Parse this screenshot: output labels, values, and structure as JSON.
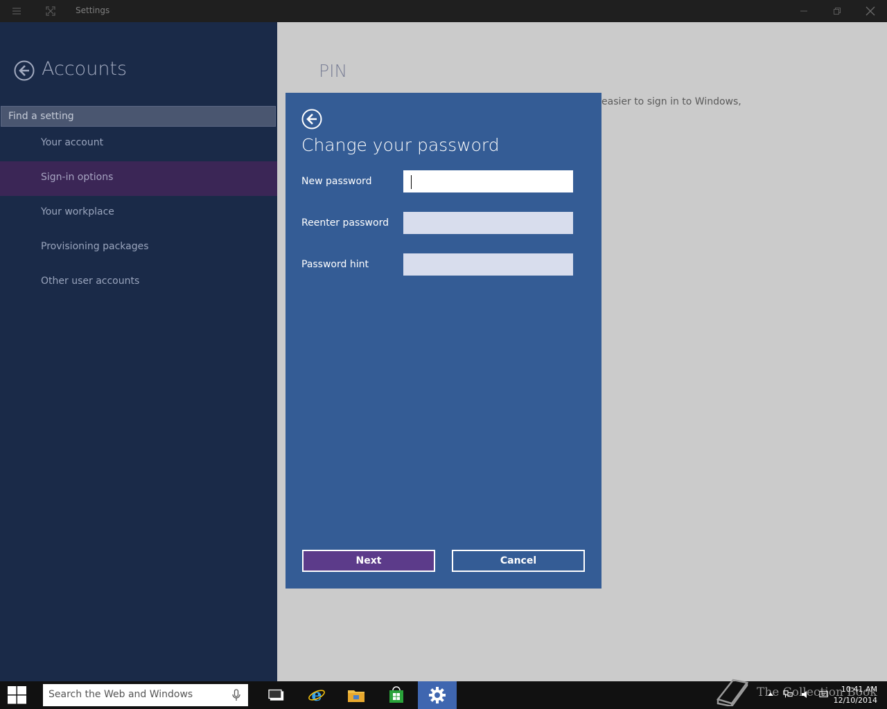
{
  "window": {
    "title": "Settings"
  },
  "sidebar": {
    "section_title": "Accounts",
    "search_placeholder": "Find a setting",
    "items": [
      {
        "label": "Your account",
        "selected": false
      },
      {
        "label": "Sign-in options",
        "selected": true
      },
      {
        "label": "Your workplace",
        "selected": false
      },
      {
        "label": "Provisioning packages",
        "selected": false
      },
      {
        "label": "Other user accounts",
        "selected": false
      }
    ]
  },
  "content": {
    "title": "PIN",
    "description_fragment": "easier to sign in to Windows,"
  },
  "dialog": {
    "title": "Change your password",
    "fields": [
      {
        "label": "New password",
        "value": ""
      },
      {
        "label": "Reenter password",
        "value": ""
      },
      {
        "label": "Password hint",
        "value": ""
      }
    ],
    "next_label": "Next",
    "cancel_label": "Cancel"
  },
  "taskbar": {
    "search_placeholder": "Search the Web and Windows",
    "time": "10:41 AM",
    "date": "12/10/2014"
  },
  "watermark": {
    "text": "The Collection Book"
  },
  "colors": {
    "sidebar_bg": "#1a2a48",
    "selected_item_bg": "#3b2656",
    "dialog_bg": "#345c95",
    "next_button_bg": "#5c3b8a",
    "taskbar_active": "#3f66b0"
  }
}
